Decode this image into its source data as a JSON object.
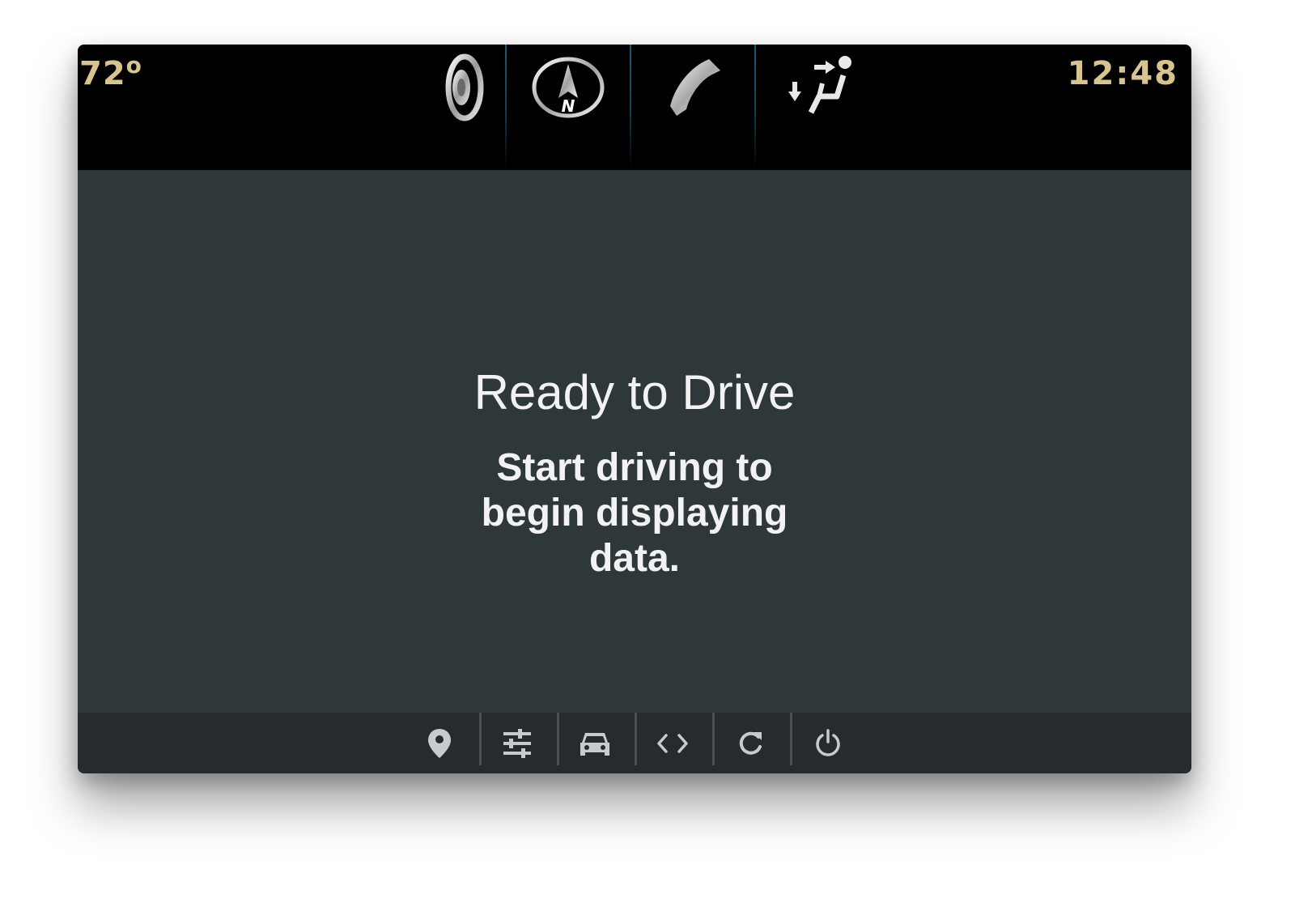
{
  "status_bar": {
    "temperature_value": "72",
    "temperature_unit": "o",
    "clock": "12:48",
    "text_color": "#d8c48e",
    "icons": [
      {
        "name": "volume-icon"
      },
      {
        "name": "navigation-icon",
        "label": "N"
      },
      {
        "name": "phone-icon"
      },
      {
        "name": "climate-seat-icon"
      }
    ]
  },
  "main": {
    "title": "Ready to Drive",
    "subtitle": "Start driving to begin displaying data."
  },
  "toolbar": {
    "icons": [
      {
        "name": "location-pin-icon"
      },
      {
        "name": "settings-sliders-icon"
      },
      {
        "name": "car-icon"
      },
      {
        "name": "code-icon"
      },
      {
        "name": "refresh-icon"
      },
      {
        "name": "power-icon"
      }
    ],
    "icon_color": "#c8cbcc"
  },
  "colors": {
    "top_bar": "#000000",
    "main_background": "#2e3739",
    "bottom_bar": "#262b2f",
    "separator_accent": "#1c5a74"
  }
}
